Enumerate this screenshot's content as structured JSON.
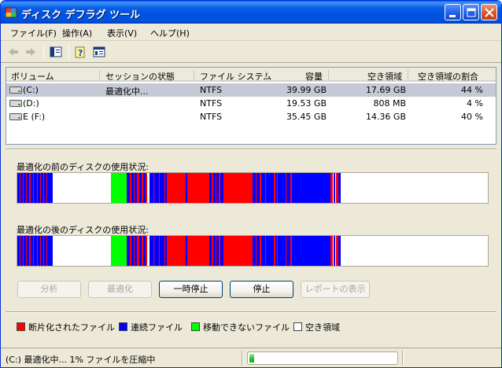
{
  "window": {
    "title": "ディスク デフラグ ツール",
    "minimize_icon": "minimize-icon",
    "maximize_icon": "maximize-icon",
    "close_icon": "close-icon"
  },
  "menu": {
    "items": [
      "ファイル(F)",
      "操作(A)",
      "表示(V)",
      "ヘルプ(H)"
    ]
  },
  "toolbar": {
    "icons": [
      "back-arrow-icon",
      "forward-arrow-icon",
      "console-tree-icon",
      "help-icon",
      "properties-icon"
    ]
  },
  "volume_list": {
    "columns": [
      "ボリューム",
      "セッションの状態",
      "ファイル システム",
      "容量",
      "空き領域",
      "空き領域の割合"
    ],
    "rows": [
      {
        "volume": "(C:)",
        "status": "最適化中...",
        "fs": "NTFS",
        "capacity": "39.99 GB",
        "free": "17.69 GB",
        "percent": "44 %",
        "selected": true
      },
      {
        "volume": "(D:)",
        "status": "",
        "fs": "NTFS",
        "capacity": "19.53 GB",
        "free": "808 MB",
        "percent": "4 %",
        "selected": false
      },
      {
        "volume": "E (F:)",
        "status": "",
        "fs": "NTFS",
        "capacity": "35.45 GB",
        "free": "14.36 GB",
        "percent": "40 %",
        "selected": false
      }
    ]
  },
  "before_label": "最適化の前のディスクの使用状況:",
  "after_label": "最適化の後のディスクの使用状況:",
  "buttons": {
    "analyze": "分析",
    "defragment": "最適化",
    "pause": "一時停止",
    "stop": "停止",
    "report": "レポートの表示"
  },
  "legend": {
    "fragmented": "断片化されたファイル",
    "contiguous": "連続ファイル",
    "unmovable": "移動できないファイル",
    "free": "空き領域"
  },
  "colors": {
    "fragmented": "#ff0000",
    "contiguous": "#0000ff",
    "unmovable": "#00ff00",
    "free": "#ffffff"
  },
  "status": {
    "text": "(C:) 最適化中... 1% ファイルを圧縮中",
    "progress": 0.02
  }
}
